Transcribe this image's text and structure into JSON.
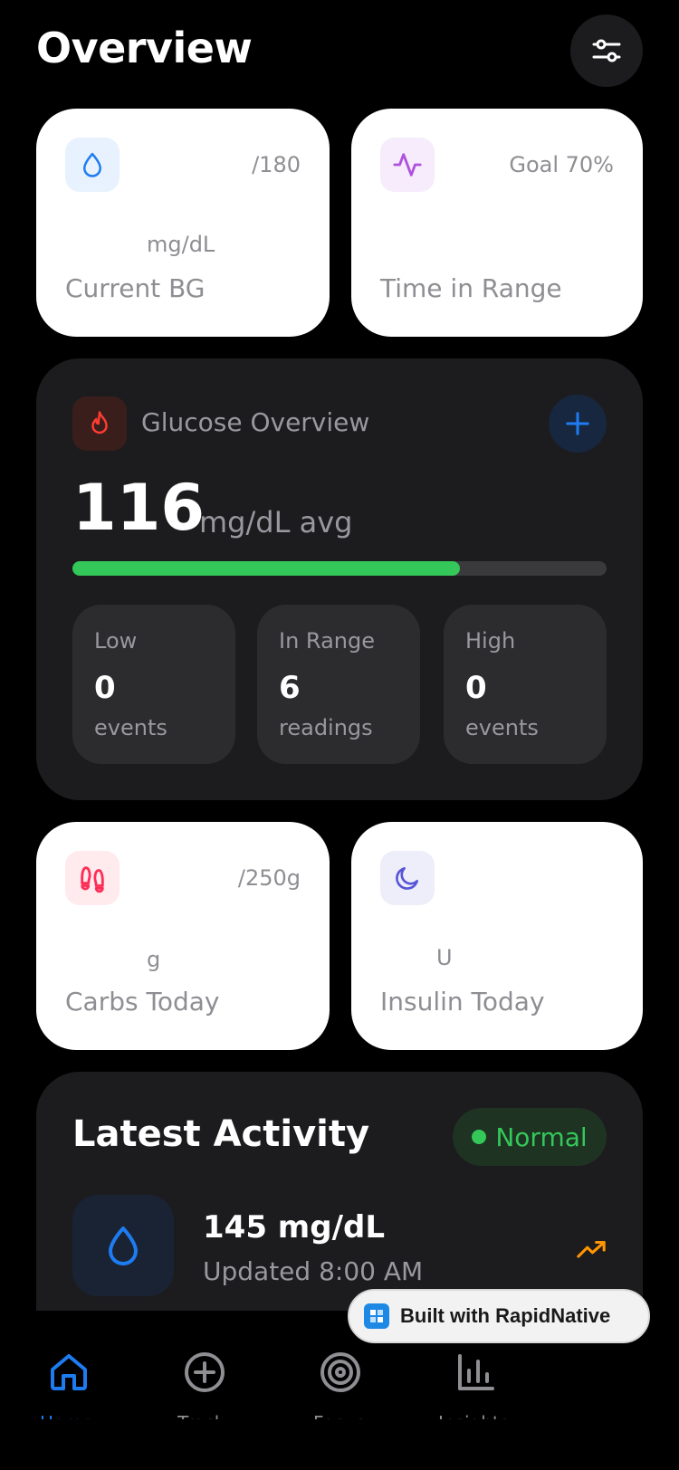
{
  "header": {
    "title": "Overview"
  },
  "cards": {
    "current_bg": {
      "goal": "/180",
      "unit": "mg/dL",
      "label": "Current BG"
    },
    "time_in_range": {
      "goal": "Goal 70%",
      "label": "Time in Range"
    },
    "carbs": {
      "goal": "/250g",
      "unit": "g",
      "label": "Carbs Today"
    },
    "insulin": {
      "unit": "U",
      "label": "Insulin Today"
    }
  },
  "glucose": {
    "title": "Glucose Overview",
    "value": "116",
    "unit": "mg/dL avg",
    "progress_fraction": 0.726,
    "stats": [
      {
        "label": "Low",
        "value": "0",
        "unit": "events"
      },
      {
        "label": "In Range",
        "value": "6",
        "unit": "readings"
      },
      {
        "label": "High",
        "value": "0",
        "unit": "events"
      }
    ]
  },
  "activity": {
    "title": "Latest Activity",
    "badge": "Normal",
    "reading": "145 mg/dL",
    "updated": "Updated 8:00 AM"
  },
  "tabs": [
    {
      "label": "Home",
      "icon": "home-icon",
      "active": true
    },
    {
      "label": "Track",
      "icon": "plus-circle-icon"
    },
    {
      "label": "Focus",
      "icon": "target-icon"
    },
    {
      "label": "Insights",
      "icon": "bar-chart-icon"
    }
  ],
  "built_with": "Built with RapidNative",
  "colors": {
    "accent_blue": "#1e7cf2",
    "green": "#34c759",
    "purple": "#af52de",
    "red": "#ff3b30",
    "pink": "#ff2d55",
    "indigo": "#5856d6",
    "orange": "#ff9500",
    "card_dark": "#1c1c1e"
  }
}
